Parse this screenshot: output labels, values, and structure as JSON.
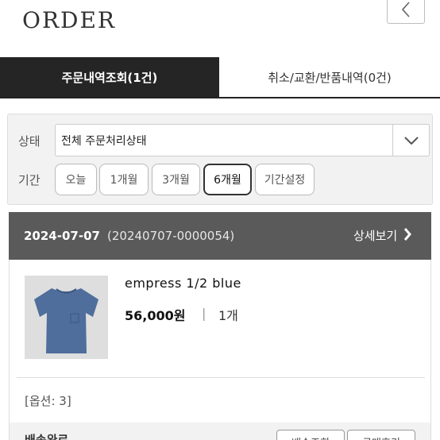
{
  "header": {
    "title": "ORDER",
    "back_icon": "chevron-left-icon"
  },
  "tabs": [
    {
      "label": "주문내역조회(1건)",
      "active": true
    },
    {
      "label": "취소/교환/반품내역(0건)",
      "active": false
    }
  ],
  "filter": {
    "status_label": "상태",
    "status_value": "전체 주문처리상태",
    "period_label": "기간",
    "periods": [
      "오늘",
      "1개월",
      "3개월",
      "6개월",
      "기간설정"
    ],
    "selected_period": "6개월"
  },
  "order": {
    "date": "2024-07-07",
    "order_number": "(20240707-0000054)",
    "detail_link": "상세보기",
    "product": {
      "name": "empress 1/2 blue",
      "price": "56,000원",
      "separator": "|",
      "quantity": "1개",
      "options": "[옵션: 3]"
    },
    "shipping_status": "배송완료",
    "actions": [
      "배송조회",
      "구매후기"
    ]
  },
  "colors": {
    "active_tab_bg": "#252525",
    "order_bar_bg": "#5a5a5a",
    "panel_bg": "#f2f2f2",
    "shirt": "#4f6e9c"
  }
}
